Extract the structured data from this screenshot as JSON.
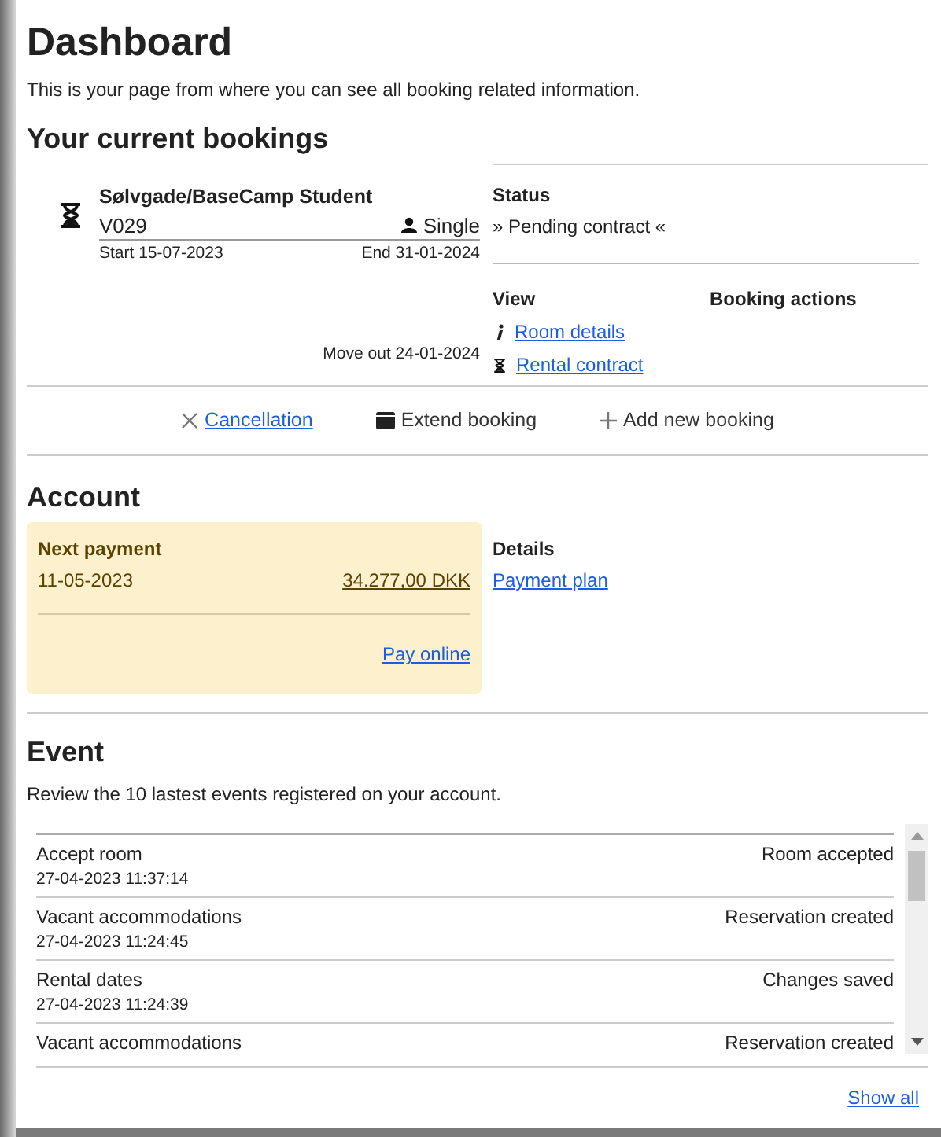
{
  "title": "Dashboard",
  "intro": "This is your page from where you can see all booking related information.",
  "bookings": {
    "heading": "Your current bookings",
    "booking": {
      "name": "Sølvgade/BaseCamp Student",
      "room": "V029",
      "type": "Single",
      "start": "Start 15-07-2023",
      "end": "End 31-01-2024",
      "move_out": "Move out 24-01-2024"
    },
    "status": {
      "label": "Status",
      "value": "» Pending contract «"
    },
    "view": {
      "label": "View",
      "links": [
        {
          "kind": "info",
          "text": "Room details"
        },
        {
          "kind": "hourglass",
          "text": "Rental contract"
        }
      ]
    },
    "booking_actions": {
      "label": "Booking actions"
    },
    "actions": [
      {
        "kind": "cancel",
        "text": "Cancellation",
        "link": true
      },
      {
        "kind": "calendar",
        "text": "Extend booking",
        "link": false
      },
      {
        "kind": "add",
        "text": "Add new booking",
        "link": false
      }
    ]
  },
  "account": {
    "heading": "Account",
    "next_payment": {
      "label": "Next payment",
      "date": "11-05-2023",
      "amount": "34.277,00 DKK",
      "pay_link": "Pay online"
    },
    "details": {
      "label": "Details",
      "link": "Payment plan"
    }
  },
  "events": {
    "heading": "Event",
    "description": "Review the 10 lastest events registered on your account.",
    "items": [
      {
        "name": "Accept room",
        "result": "Room accepted",
        "time": "27-04-2023 11:37:14"
      },
      {
        "name": "Vacant accommodations",
        "result": "Reservation created",
        "time": "27-04-2023 11:24:45"
      },
      {
        "name": "Rental dates",
        "result": "Changes saved",
        "time": "27-04-2023 11:24:39"
      },
      {
        "name": "Vacant accommodations",
        "result": "Reservation created"
      }
    ],
    "show_all": "Show all"
  }
}
